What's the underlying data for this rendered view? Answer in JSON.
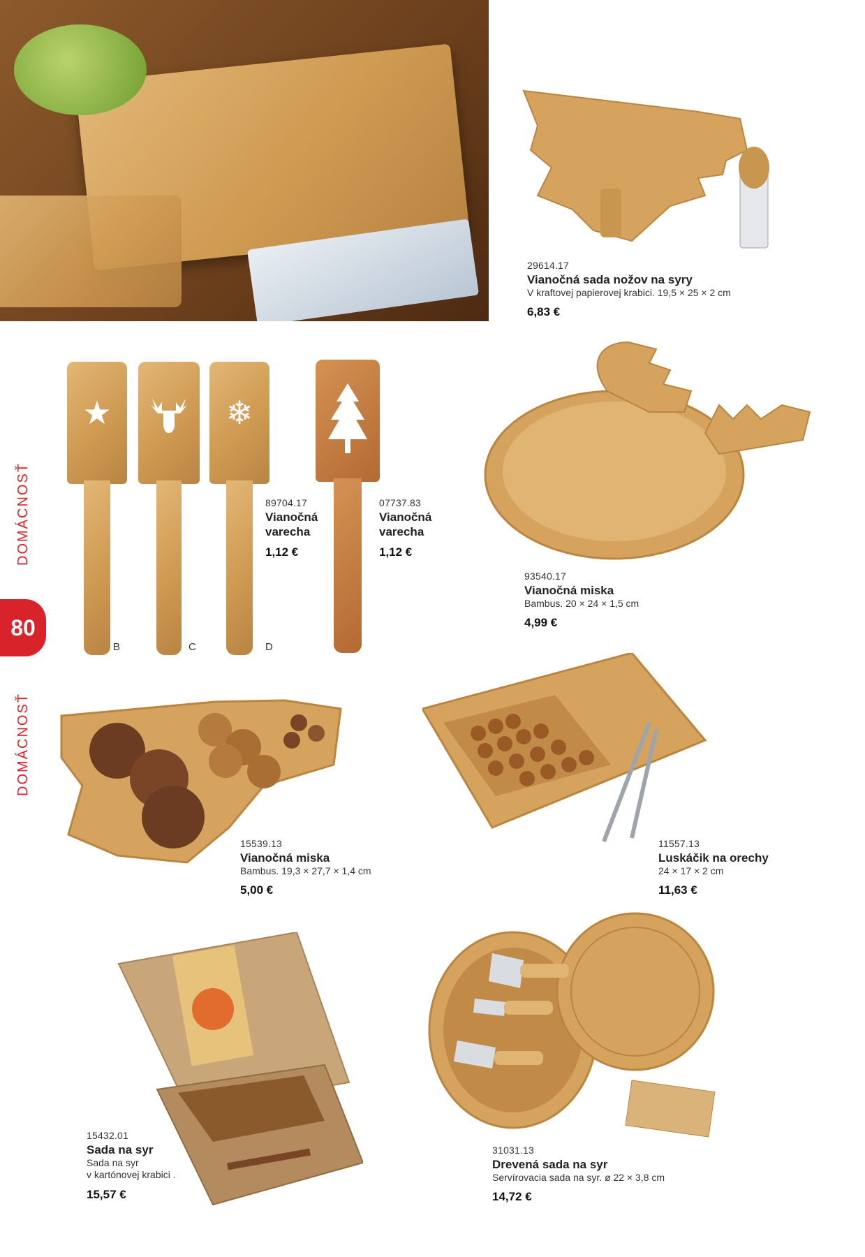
{
  "page": {
    "section_label": "DOMÁCNOSŤ",
    "page_number": "80"
  },
  "spatula_variants": [
    "B",
    "C",
    "D"
  ],
  "products": [
    {
      "code": "29614.17",
      "name": "Vianočná sada nožov na syry",
      "desc": "V kraftovej papierovej krabici. 19,5 × 25 × 2 cm",
      "price": "6,83 €"
    },
    {
      "code": "89704.17",
      "name_line1": "Vianočná",
      "name_line2": "varecha",
      "price": "1,12 €"
    },
    {
      "code": "07737.83",
      "name_line1": "Vianočná",
      "name_line2": "varecha",
      "price": "1,12 €"
    },
    {
      "code": "93540.17",
      "name": "Vianočná miska",
      "desc": "Bambus. 20 × 24 × 1,5 cm",
      "price": "4,99 €"
    },
    {
      "code": "15539.13",
      "name": "Vianočná miska",
      "desc": "Bambus. 19,3 × 27,7 × 1,4 cm",
      "price": "5,00 €"
    },
    {
      "code": "11557.13",
      "name": "Luskáčik na orechy",
      "desc": "24 × 17 × 2 cm",
      "price": "11,63 €"
    },
    {
      "code": "15432.01",
      "name": "Sada na syr",
      "desc_line1": "Sada na syr",
      "desc_line2": "v kartónovej krabici .",
      "price": "15,57 €"
    },
    {
      "code": "31031.13",
      "name": "Drevená sada na syr",
      "desc": "Servírovacia sada na syr. ø 22 × 3,8 cm",
      "price": "14,72 €"
    }
  ],
  "icons": {
    "star": "star-icon",
    "reindeer": "reindeer-icon",
    "snowflake": "snowflake-icon",
    "tree": "tree-icon"
  },
  "colors": {
    "accent": "#d8232a",
    "wood": "#d6a35f"
  }
}
